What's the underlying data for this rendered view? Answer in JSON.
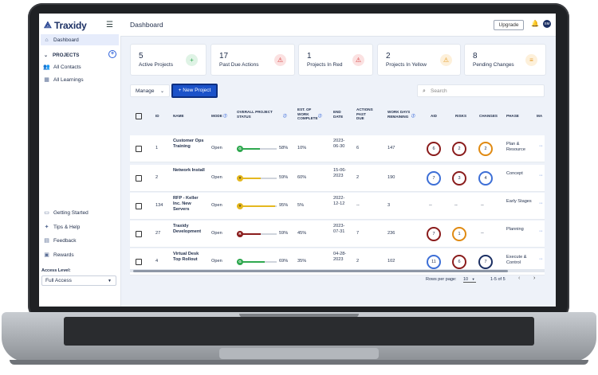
{
  "sidebar": {
    "logo": "Traxidy",
    "nav": [
      {
        "label": "Dashboard",
        "icon": "home-icon"
      }
    ],
    "projects_label": "PROJECTS",
    "project_links": [
      {
        "label": "All Contacts",
        "icon": "contacts-icon"
      },
      {
        "label": "All Learnings",
        "icon": "learnings-icon"
      }
    ],
    "bottom": [
      {
        "label": "Getting Started",
        "icon": "getting-started-icon"
      },
      {
        "label": "Tips & Help",
        "icon": "tips-icon"
      },
      {
        "label": "Feedback",
        "icon": "feedback-icon"
      },
      {
        "label": "Rewards",
        "icon": "rewards-icon"
      }
    ],
    "access_label": "Access Level:",
    "access_value": "Full Access"
  },
  "header": {
    "title": "Dashboard",
    "upgrade": "Upgrade",
    "avatar": "SM"
  },
  "cards": [
    {
      "num": "5",
      "label": "Active Projects",
      "color": "#2fa84f",
      "bg": "#dff3e5",
      "icon": "+"
    },
    {
      "num": "17",
      "label": "Past Due Actions",
      "color": "#d63b3b",
      "bg": "#fbe1e1",
      "icon": "!"
    },
    {
      "num": "1",
      "label": "Projects In Red",
      "color": "#d63b3b",
      "bg": "#fbe1e1",
      "icon": "!"
    },
    {
      "num": "2",
      "label": "Projects In Yellow",
      "color": "#e59a22",
      "bg": "#fdf0da",
      "icon": "!"
    },
    {
      "num": "8",
      "label": "Pending Changes",
      "color": "#e59a22",
      "bg": "#fdf0da",
      "icon": "≡"
    }
  ],
  "toolbar": {
    "manage": "Manage",
    "new_project": "+ New Project",
    "search_placeholder": "Search"
  },
  "columns": {
    "id": "ID",
    "name": "NAME",
    "mode": "MODE",
    "status": "OVERALL PROJECT STATUS",
    "est": "EST. OF WORK COMPLETE",
    "end": "END DATE",
    "actions": "ACTIONS PAST DUE",
    "days": "WORK DAYS REMAINING",
    "aid": "AID",
    "risks": "RISKS",
    "changes": "CHANGES",
    "phase": "PHASE",
    "more": "MA"
  },
  "rows": [
    {
      "id": "1",
      "name": "Customer Ops Training",
      "mode": "Open",
      "status_letter": "G",
      "status_color": "#2fa84f",
      "status_pct": 58,
      "status_label": "58%",
      "est": "10%",
      "end": "2023-06-30",
      "actions": "6",
      "days": "147",
      "aid": "6",
      "aid_color": "#8a1c1c",
      "risks": "2",
      "risks_color": "#8a1c1c",
      "changes": "2",
      "changes_color": "#e08a12",
      "phase": "Plan & Resource"
    },
    {
      "id": "2",
      "name": "Network Install",
      "mode": "Open",
      "status_letter": "Y",
      "status_color": "#e5b81f",
      "status_pct": 59,
      "status_label": "59%",
      "est": "60%",
      "end": "15-06-2023",
      "actions": "2",
      "days": "190",
      "aid": "7",
      "aid_color": "#3d6fd6",
      "risks": "3",
      "risks_color": "#8a1c1c",
      "changes": "4",
      "changes_color": "#3d6fd6",
      "phase": "Concept"
    },
    {
      "id": "134",
      "name": "RFP - Keller Inc. New Servers",
      "mode": "Open",
      "status_letter": "Y",
      "status_color": "#e5b81f",
      "status_pct": 95,
      "status_label": "95%",
      "est": "5%",
      "end": "2022-12-12",
      "actions": "--",
      "days": "3",
      "aid": "--",
      "risks": "--",
      "changes": "--",
      "phase": "Early Stages"
    },
    {
      "id": "27",
      "name": "Traxidy Development",
      "mode": "Open",
      "status_letter": "R",
      "status_color": "#8a1c1c",
      "status_pct": 59,
      "status_label": "59%",
      "est": "45%",
      "end": "2023-07-31",
      "actions": "7",
      "days": "236",
      "aid": "7",
      "aid_color": "#8a1c1c",
      "risks": "1",
      "risks_color": "#e08a12",
      "changes": "--",
      "phase": "Planning"
    },
    {
      "id": "4",
      "name": "Virtual Desk Top Rollout",
      "mode": "Open",
      "status_letter": "G",
      "status_color": "#2fa84f",
      "status_pct": 69,
      "status_label": "69%",
      "est": "35%",
      "end": "04-28-2023",
      "actions": "2",
      "days": "102",
      "aid": "11",
      "aid_color": "#3d6fd6",
      "risks": "6",
      "risks_color": "#8a1c1c",
      "changes": "7",
      "changes_color": "#1b2f63",
      "phase": "Execute & Control"
    }
  ],
  "pagination": {
    "rows_label": "Rows per page:",
    "rows_value": "10",
    "range": "1-5 of 5"
  }
}
